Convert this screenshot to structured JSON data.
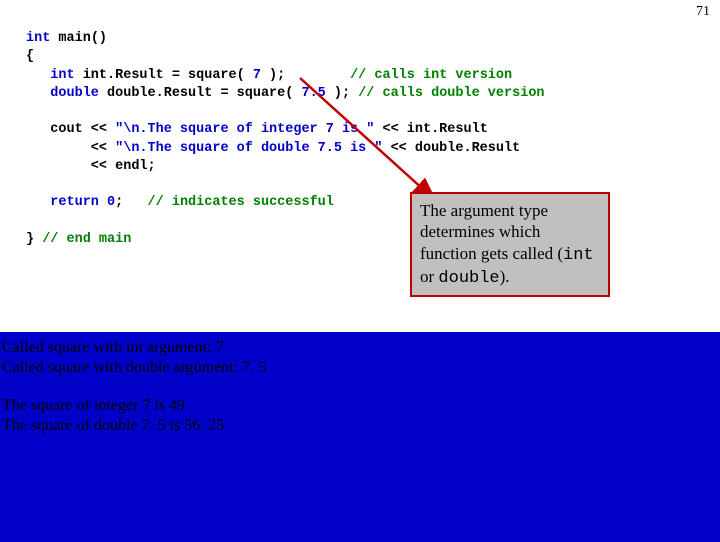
{
  "pageNumber": "71",
  "code": {
    "l1a": "int",
    "l1b": " main()",
    "l2": "{",
    "l3a": "   int",
    "l3b": " int.Result = square( ",
    "l3c": "7",
    "l3d": " );        ",
    "l3e": "// calls int version",
    "l4a": "   double",
    "l4b": " double.Result = square( ",
    "l4c": "7.5",
    "l4d": " ); ",
    "l4e": "// calls double version",
    "blank1": "",
    "l5a": "   cout << ",
    "l5b": "\"\\n.The square of integer 7 is \"",
    "l5c": " << int.Result",
    "l6a": "        << ",
    "l6b": "\"\\n.The square of double 7.5 is \"",
    "l6c": " << double.Result",
    "l7": "        << endl;  ",
    "blank2": "",
    "l8a": "   return",
    "l8b": " ",
    "l8c": "0",
    "l8d": ";   ",
    "l8e": "// indicates successful ",
    "blank3": "",
    "l9a": "} ",
    "l9b": "// end main"
  },
  "callout": {
    "line1": "The argument type determines which function gets called (",
    "mono1": "int",
    "mid": " or ",
    "mono2": "double",
    "end": ")."
  },
  "output": {
    "o1": "Called square with int argument: 7",
    "o2": "Called square with double argument: 7. 5",
    "o3": "The square of integer 7 is 49",
    "o4": "The square of double 7. 5 is 56. 25"
  }
}
